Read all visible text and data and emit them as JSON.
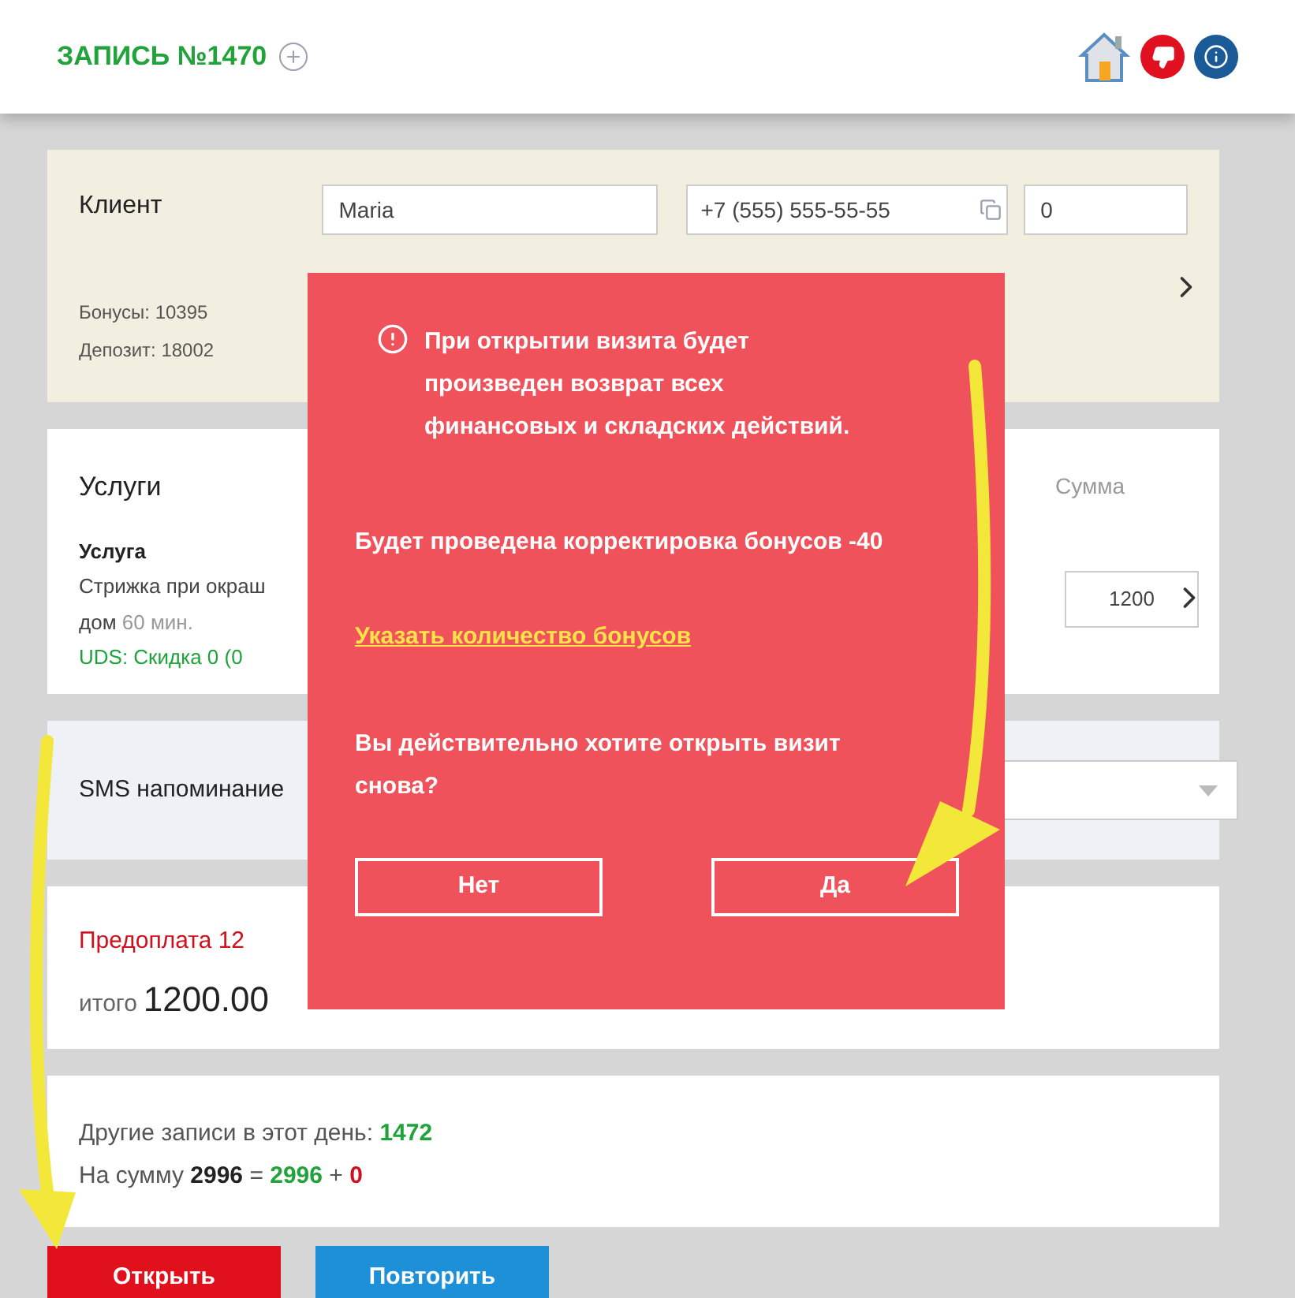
{
  "header": {
    "title": "ЗАПИСЬ №1470"
  },
  "client": {
    "label": "Клиент",
    "name": "Maria",
    "phone": "+7 (555) 555-55-55",
    "count": "0",
    "bonuses": "Бонусы: 10395",
    "deposit": "Депозит: 18002"
  },
  "services": {
    "title": "Услуги",
    "columns": [
      "Сумма"
    ],
    "item": {
      "title": "Услуга",
      "name_fragment": "Стрижка при окраш",
      "line2": "дом",
      "duration": "60 мин.",
      "uds": "UDS: Скидка 0 (0",
      "sum": "1200"
    }
  },
  "sms": {
    "label": "SMS напоминание"
  },
  "payment": {
    "prepay": "Предоплата 12",
    "total_label": "итого",
    "total": "1200.00"
  },
  "summary": {
    "other_label": "Другие записи в этот день:",
    "other_count": "1472",
    "sum_label": "На сумму",
    "sum_total": "2996",
    "equals": "=",
    "sum_a": "2996",
    "plus": "+",
    "sum_b": "0"
  },
  "buttons": [
    {
      "label": "Открыть",
      "kind": "danger"
    },
    {
      "label": "Повторить",
      "kind": "primary"
    }
  ],
  "dialog": {
    "message": "При открытии визита будет произведен возврат всех финансовых и складских действий.",
    "bonus_note": "Будет проведена корректировка бонусов -40",
    "link": "Указать количество бонусов",
    "question": "Вы действительно хотите открыть визит снова?",
    "buttons": [
      "Нет",
      "Да"
    ]
  }
}
